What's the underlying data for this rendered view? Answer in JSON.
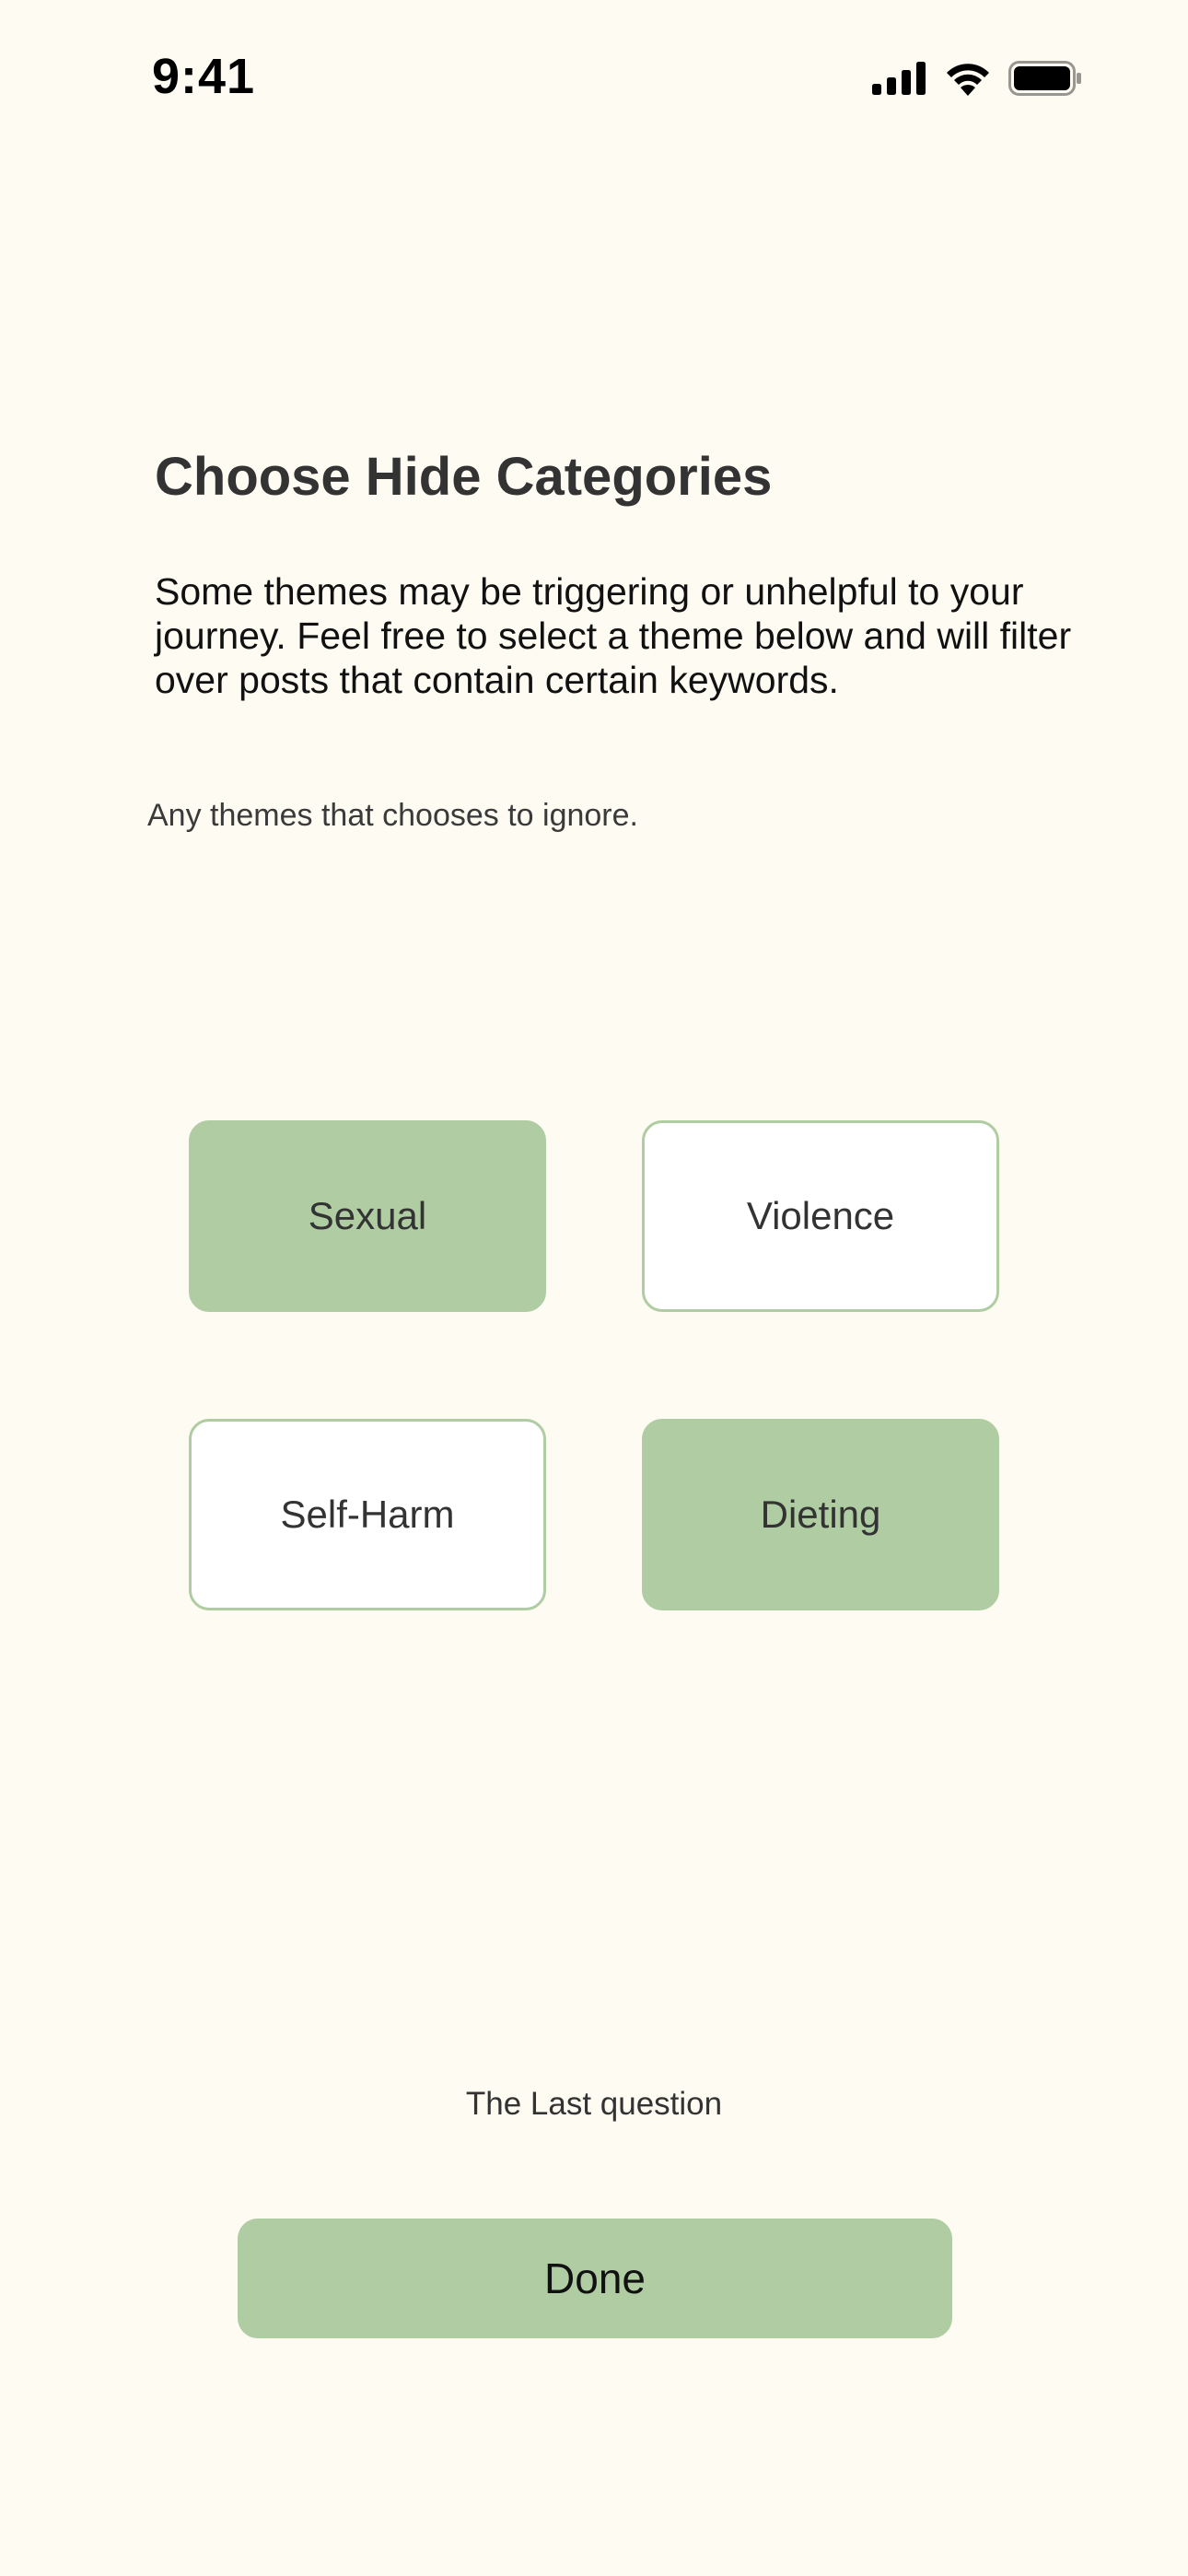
{
  "status_bar": {
    "time": "9:41",
    "icons": [
      "cellular-signal-icon",
      "wifi-icon",
      "battery-icon"
    ]
  },
  "screen": {
    "title": "Choose Hide Categories",
    "description": "Some themes may be triggering or unhelpful to your journey. Feel free to select a theme below and will filter over posts that contain certain keywords.",
    "hint": "Any themes that chooses to ignore."
  },
  "categories": [
    {
      "label": "Sexual",
      "selected": true
    },
    {
      "label": "Violence",
      "selected": false
    },
    {
      "label": "Self-Harm",
      "selected": false
    },
    {
      "label": "Dieting",
      "selected": true
    }
  ],
  "footer": {
    "note": "The Last question",
    "done_label": "Done"
  },
  "colors": {
    "background": "#fdfbf2",
    "accent": "#afcca2",
    "card_unselected": "#ffffff"
  }
}
